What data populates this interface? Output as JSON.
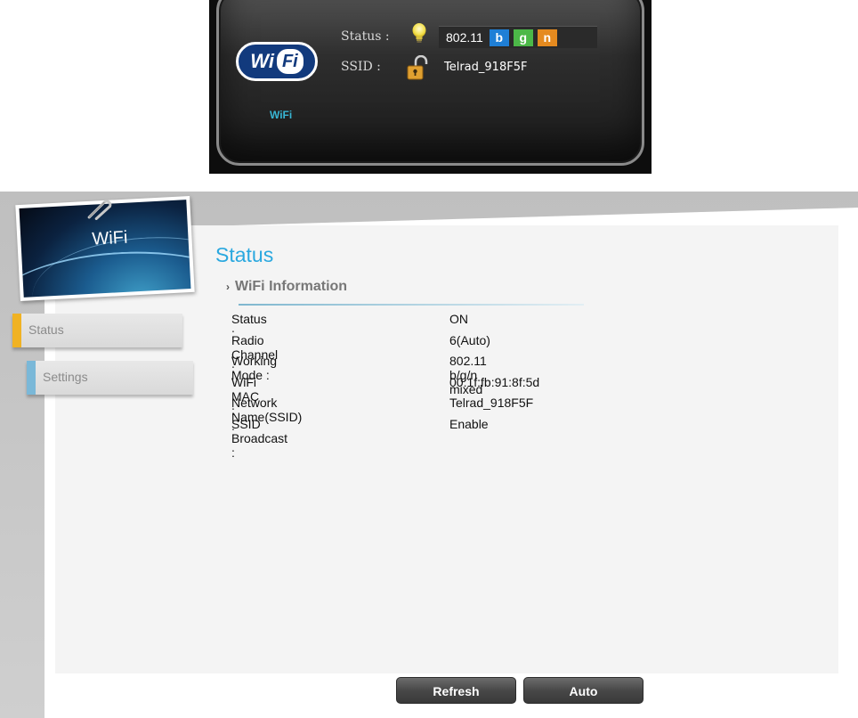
{
  "widget": {
    "logo_wi": "Wi",
    "logo_fi": "Fi",
    "status_label": "Status :",
    "ssid_label": "SSID :",
    "standard": "802.11",
    "modes": [
      {
        "label": "b",
        "bg": "#1f7fd6",
        "color": "#ffffff"
      },
      {
        "label": "g",
        "bg": "#4cb848",
        "color": "#ffffff"
      },
      {
        "label": "n",
        "bg": "#e58a1f",
        "color": "#ffffff"
      }
    ],
    "ssid_value": "Telrad_918F5F",
    "caption": "WiFi"
  },
  "photo": {
    "title": "WiFi"
  },
  "sidebar": {
    "items": [
      {
        "label": "Status",
        "accent": "#f0b223"
      },
      {
        "label": "Settings",
        "accent": "#7ab8d8"
      }
    ]
  },
  "main": {
    "title": "Status",
    "section": "WiFi Information",
    "rows": [
      {
        "label": "Status :",
        "value": "ON"
      },
      {
        "label": "Radio Channel :",
        "value": "6(Auto)"
      },
      {
        "label": "Working Mode :",
        "value": "802.11 b/g/n mixed"
      },
      {
        "label": "WiFi MAC :",
        "value": "00:1f:fb:91:8f:5d"
      },
      {
        "label": "Network Name(SSID) :",
        "value": "Telrad_918F5F"
      },
      {
        "label": "SSID Broadcast :",
        "value": "Enable"
      }
    ]
  },
  "buttons": {
    "refresh": "Refresh",
    "auto": "Auto"
  }
}
